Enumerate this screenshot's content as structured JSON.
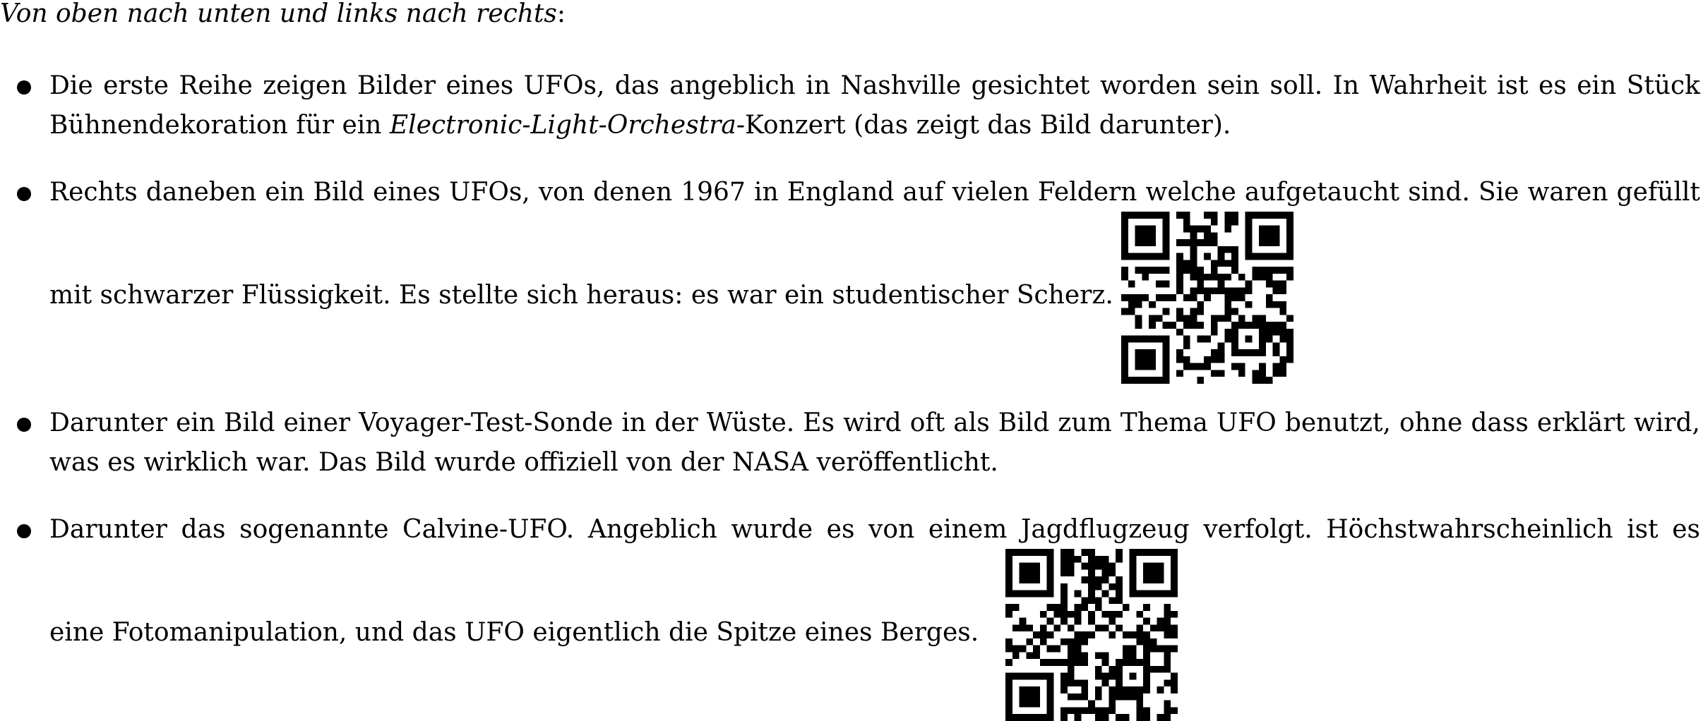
{
  "intro": {
    "lead": "Von oben nach unten und links nach rechts",
    "colon": ":"
  },
  "items": [
    {
      "line1": "Die erste Reihe zeigen Bilder eines UFOs, das angeblich in Nashville gesichtet worden sein soll. In Wahrheit ist es ein Stück",
      "line2_pre": "Bühnendekoration für ein ",
      "line2_em": "Electronic-Light-Orchestra",
      "line2_post": "-Konzert (das zeigt das Bild darunter)."
    },
    {
      "line1": "Rechts daneben ein Bild eines UFOs, von denen 1967 in England auf vielen Feldern welche aufgetaucht sind. Sie waren gefüllt",
      "line2": "mit schwarzer Flüssigkeit. Es stellte sich heraus: es war ein studentischer Scherz."
    },
    {
      "line1": "Darunter ein Bild einer Voyager-Test-Sonde in der Wüste. Es wird oft als Bild zum Thema UFO benutzt, ohne dass erklärt wird,",
      "line2": "was es wirklich war. Das Bild wurde offiziell von der NASA veröffentlicht."
    },
    {
      "line1": "Darunter das sogenannte Calvine-UFO. Angeblich wurde es von einem Jagdflugzeug verfolgt. Höchstwahrscheinlich ist es",
      "line2": "eine Fotomanipulation, und das UFO eigentlich die Spitze eines Berges."
    }
  ],
  "icons": {
    "qr_1": "qr-code-icon",
    "qr_2": "qr-code-icon"
  },
  "colors": {
    "text": "#000000",
    "background": "#ffffff"
  }
}
